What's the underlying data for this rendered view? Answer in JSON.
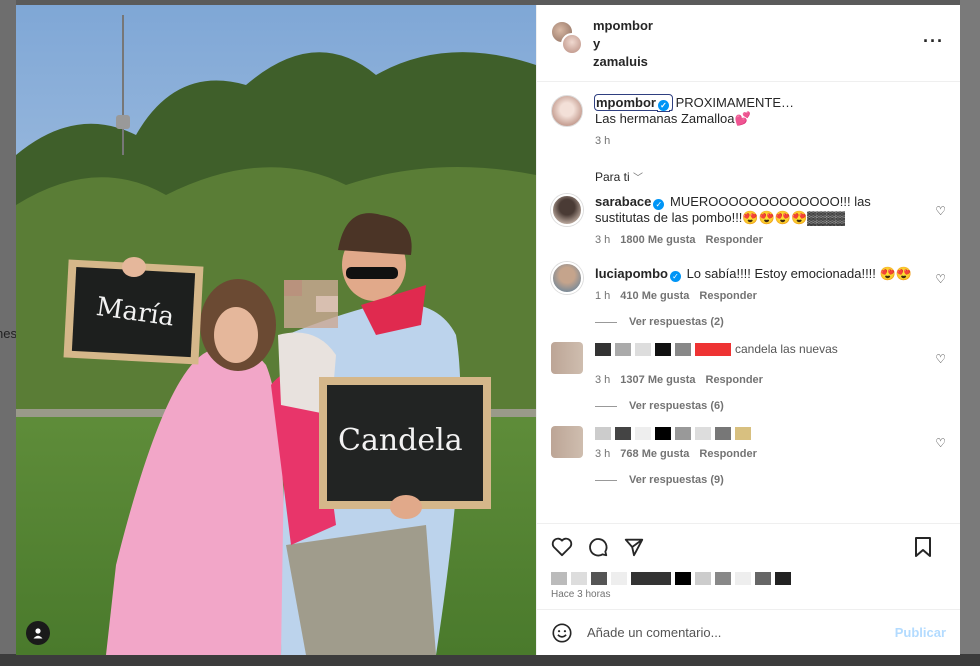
{
  "background": {
    "left_fragment": "nes"
  },
  "header": {
    "user1": "mpombor",
    "connector": "y",
    "user2": "zamaluis",
    "more_icon": "more-horizontal-icon"
  },
  "caption": {
    "username": "mpombor",
    "text_line1": "PROXIMAMENTE…",
    "text_line2": "Las hermanas Zamalloa💕",
    "time": "3 h"
  },
  "sort_label": "Para ti",
  "comments": [
    {
      "username": "sarabace",
      "text": "MUEROOOOOOOOOOOOO!!! las sustitutas de las pombo!!!😍😍😍😍▓▓▓▓",
      "time": "3 h",
      "likes": "1800 Me gusta",
      "reply": "Responder"
    },
    {
      "username": "luciapombo",
      "text": "Lo sabía!!!! Estoy emocionada!!!! 😍😍",
      "time": "1 h",
      "likes": "410 Me gusta",
      "reply": "Responder",
      "replies": "Ver respuestas (2)"
    },
    {
      "text_fragment": "candela las nuevas",
      "time": "3 h",
      "likes": "1307 Me gusta",
      "reply": "Responder",
      "replies": "Ver respuestas (6)"
    },
    {
      "time": "3 h",
      "likes": "768 Me gusta",
      "reply": "Responder",
      "replies": "Ver respuestas (9)"
    }
  ],
  "photo": {
    "board1": "María",
    "board2": "Candela"
  },
  "footer": {
    "time_ago": "Hace 3 horas",
    "comment_placeholder": "Añade un comentario...",
    "publish": "Publicar"
  }
}
